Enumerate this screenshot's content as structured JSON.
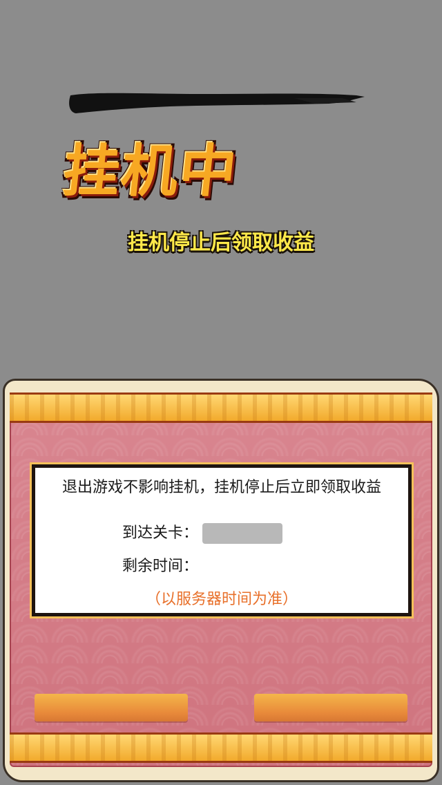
{
  "title": "挂机中",
  "subtitle": "挂机停止后领取收益",
  "panel": {
    "notice": "退出游戏不影响挂机，挂机停止后立即领取收益",
    "level_label": "到达关卡：",
    "level_value": "",
    "time_label": "剩余时间：",
    "time_value": "",
    "server_note": "（以服务器时间为准）"
  },
  "buttons": {
    "left_label": "",
    "right_label": ""
  },
  "colors": {
    "background": "#8c8c8c",
    "title_gold": "#f7a823",
    "subtitle_yellow": "#ffe94a",
    "panel_pink": "#d67d86",
    "band_gold": "#ffd773",
    "note_orange": "#e8702a",
    "button_orange": "#e8893a"
  },
  "icons": {
    "brush": "ink-brush-stroke"
  }
}
